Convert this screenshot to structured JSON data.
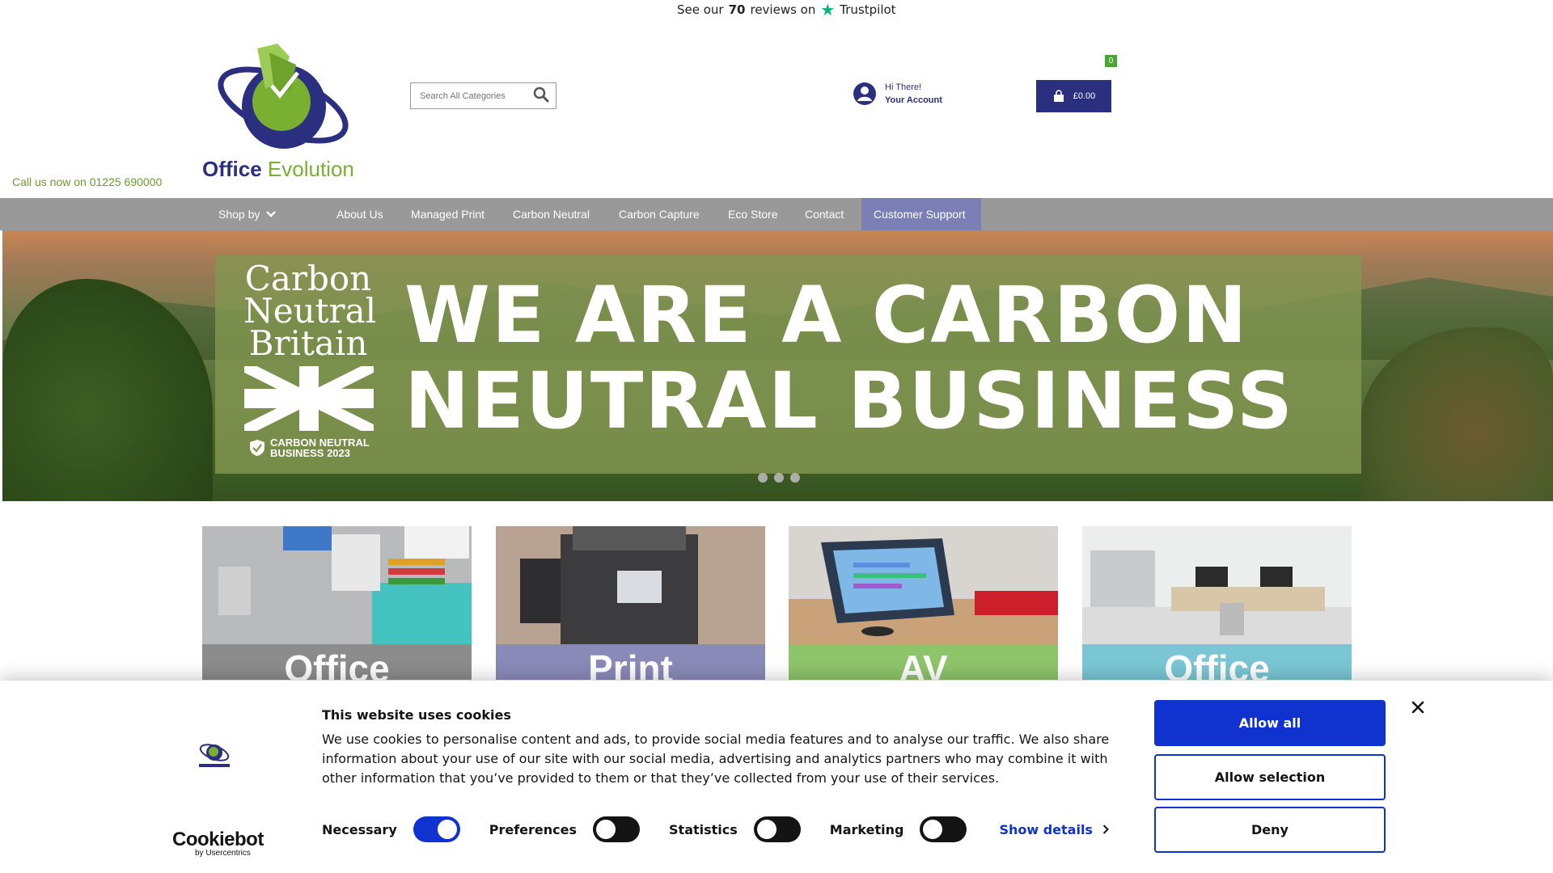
{
  "trustpilot": {
    "prefix": "See our",
    "count": "70",
    "suffix": "reviews on",
    "brand": "Trustpilot"
  },
  "logo": {
    "word1": "Office",
    "word2": "Evolution"
  },
  "callus": "Call us now on 01225 690000",
  "search": {
    "placeholder": "Search All Categories"
  },
  "account": {
    "greeting": "Hi There!",
    "link": "Your Account"
  },
  "cart": {
    "total": "£0.00",
    "count": "0"
  },
  "nav": {
    "shop_by": "Shop by",
    "items": [
      "About Us",
      "Managed Print",
      "Carbon Neutral",
      "Carbon Capture",
      "Eco Store",
      "Contact",
      "Customer Support"
    ]
  },
  "banner": {
    "cnb_line1": "Carbon",
    "cnb_line2": "Neutral",
    "cnb_line3": "Britain",
    "badge_line1": "CARBON NEUTRAL",
    "badge_line2": "BUSINESS 2023",
    "headline_line1": "WE ARE A CARBON",
    "headline_line2": "NEUTRAL BUSINESS",
    "slides": 3
  },
  "categories": [
    {
      "label": "Office",
      "color": "#8c8c8c"
    },
    {
      "label": "Print",
      "color": "#8a8ab8"
    },
    {
      "label": "AV",
      "color": "#8ec46a"
    },
    {
      "label": "Office",
      "color": "#7ac6d4"
    }
  ],
  "cookie": {
    "title": "This website uses cookies",
    "text": "We use cookies to personalise content and ads, to provide social media features and to analyse our traffic. We also share information about your use of our site with our social media, advertising and analytics partners who may combine it with other information that you’ve provided to them or that they’ve collected from your use of their services.",
    "toggles": [
      {
        "label": "Necessary",
        "on": true
      },
      {
        "label": "Preferences",
        "on": false
      },
      {
        "label": "Statistics",
        "on": false
      },
      {
        "label": "Marketing",
        "on": false
      }
    ],
    "show_details": "Show details",
    "allow_all": "Allow all",
    "allow_selection": "Allow selection",
    "deny": "Deny",
    "cookiebot_name": "Cookiebot",
    "cookiebot_sub": "by Usercentrics"
  },
  "colors": {
    "brand_navy": "#2a2f7f",
    "brand_green": "#7ab032",
    "nav_bg": "#999999",
    "nav_active": "#7a7fb5",
    "cookie_blue": "#1032cf"
  }
}
